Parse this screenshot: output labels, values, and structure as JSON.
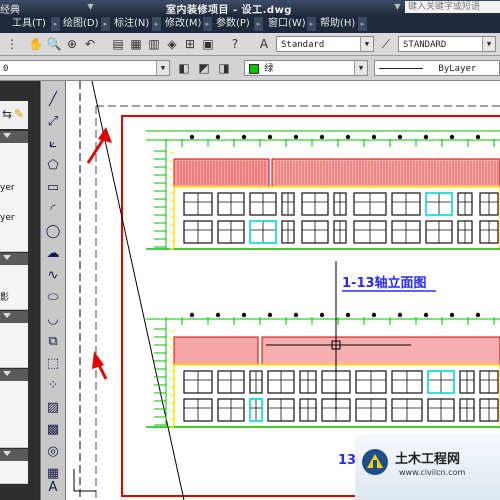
{
  "titlebar": {
    "left_text": "经典",
    "document_title": "室内装修项目 - 设工.dwg",
    "search_placeholder": "键入关键字或短语"
  },
  "menubar": {
    "items": [
      {
        "label": "工具(T)"
      },
      {
        "label": "绘图(D)"
      },
      {
        "label": "标注(N)"
      },
      {
        "label": "修改(M)"
      },
      {
        "label": "参数(P)"
      },
      {
        "label": "窗口(W)"
      },
      {
        "label": "帮助(H)"
      }
    ]
  },
  "toolbar1": {
    "text_style": "Standard",
    "dim_style": "STANDARD"
  },
  "toolbar2": {
    "layer_value": "0",
    "color_label": "绿",
    "linetype_label": "ByLayer"
  },
  "leftpanel": {
    "rows": [
      "yer",
      "yer",
      "影"
    ]
  },
  "drawing": {
    "elevation_title": "1-13轴立面图",
    "second_title_partial": "13"
  },
  "watermark": {
    "brand": "土木工程网",
    "url": "www.civilcn.com"
  },
  "colors": {
    "frame_red": "#e00000",
    "roof_red": "#f27a7a",
    "wall_yellow": "#ffe600",
    "dim_green": "#00c000",
    "glass_cyan": "#00e6e6",
    "title_blue": "#2a2aff"
  }
}
